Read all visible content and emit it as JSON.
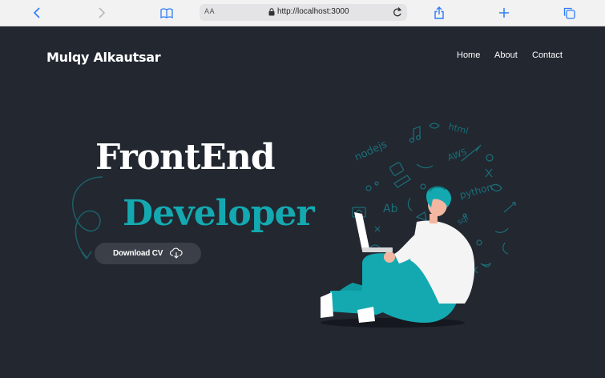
{
  "browser": {
    "text_size_label": "AA",
    "url": "http://localhost:3000"
  },
  "site": {
    "brand": "Mulqy Alkautsar",
    "nav": [
      {
        "label": "Home"
      },
      {
        "label": "About"
      },
      {
        "label": "Contact"
      }
    ]
  },
  "hero": {
    "line1": "FrontEnd",
    "line2": "Developer",
    "cta_label": "Download CV"
  },
  "illustration": {
    "doodle_words": [
      "nodejs",
      "html",
      "AWS",
      "python",
      "Ab",
      "sql"
    ]
  },
  "colors": {
    "page_bg": "#222730",
    "accent": "#14a9b0",
    "doodle": "#1b6f78",
    "button_bg": "#3b3f48"
  }
}
